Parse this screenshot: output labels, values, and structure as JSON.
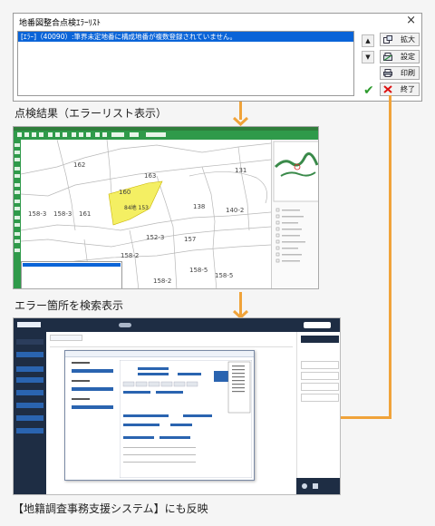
{
  "error_dialog": {
    "title": "地番図整合点検ｴﾗｰﾘｽﾄ",
    "close_glyph": "×",
    "rows": [
      "[ｴﾗｰ]（40090）:筆界未定地番に構成地番が複数登録されていません。"
    ],
    "buttons": {
      "zoom": "拡大",
      "settings": "設定",
      "print": "印刷",
      "exit": "終了"
    }
  },
  "captions": {
    "step1": "点検結果（エラーリスト表示）",
    "step2": "エラー箇所を検索表示",
    "step3": "【地籍調査事務支援システム】にも反映"
  },
  "gis_map": {
    "parcels": [
      "162",
      "163",
      "131",
      "160",
      "161",
      "138",
      "140-2",
      "152-3",
      "157",
      "158-2",
      "158-5",
      "158-2",
      "158-5",
      "158-3",
      "158-3"
    ],
    "highlighted_parcel": "84地 153"
  },
  "colors": {
    "connector": "#f0a33a",
    "gis_toolbar": "#2f9a4a",
    "system_nav": "#1e2d44",
    "selection": "#0a64d8",
    "highlight": "#f4ef63"
  }
}
